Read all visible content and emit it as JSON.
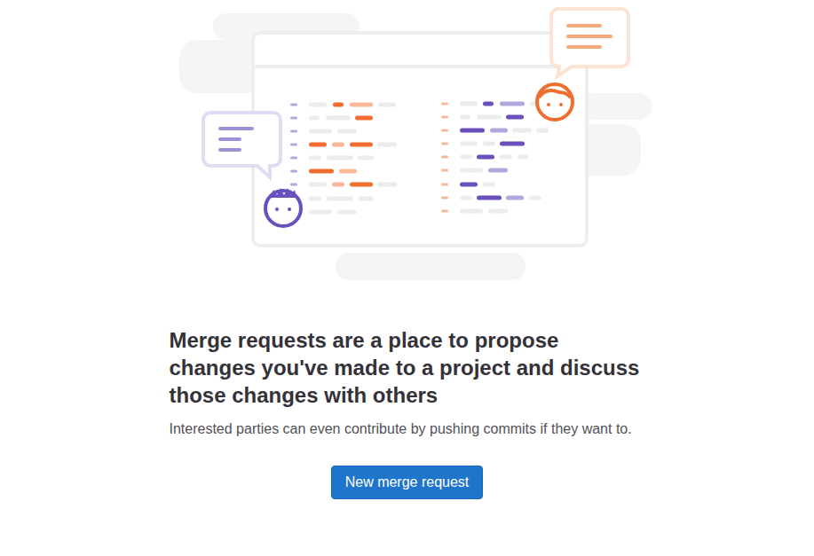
{
  "empty_state": {
    "title": "Merge requests are a place to propose changes you've made to a project and discuss those changes with others",
    "description": "Interested parties can even contribute by pushing commits if they want to.",
    "button": "New merge request"
  }
}
